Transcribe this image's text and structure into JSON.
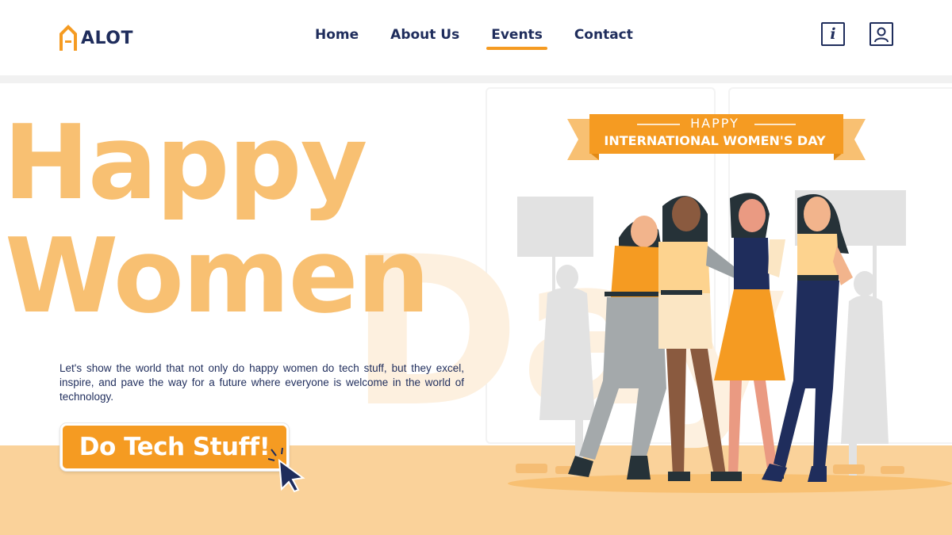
{
  "header": {
    "logo_text": "ALOT",
    "nav": [
      {
        "label": "Home",
        "active": false
      },
      {
        "label": "About Us",
        "active": false
      },
      {
        "label": "Events",
        "active": true
      },
      {
        "label": "Contact",
        "active": false
      }
    ],
    "icons": [
      "info-icon",
      "user-icon"
    ]
  },
  "hero": {
    "headline_1": "Happy",
    "headline_2": "Women",
    "background_word": "Day",
    "description": "Let's show the world that not only do happy women do tech stuff, but they excel, inspire, and pave the way for a future where everyone is welcome in the world of technology.",
    "cta_label": "Do Tech Stuff!"
  },
  "banner": {
    "line1": "HAPPY",
    "line2": "INTERNATIONAL WOMEN'S DAY"
  },
  "colors": {
    "navy": "#1f2d5c",
    "orange": "#f59b22",
    "light_orange": "#f8c072",
    "floor": "#fad29a"
  }
}
